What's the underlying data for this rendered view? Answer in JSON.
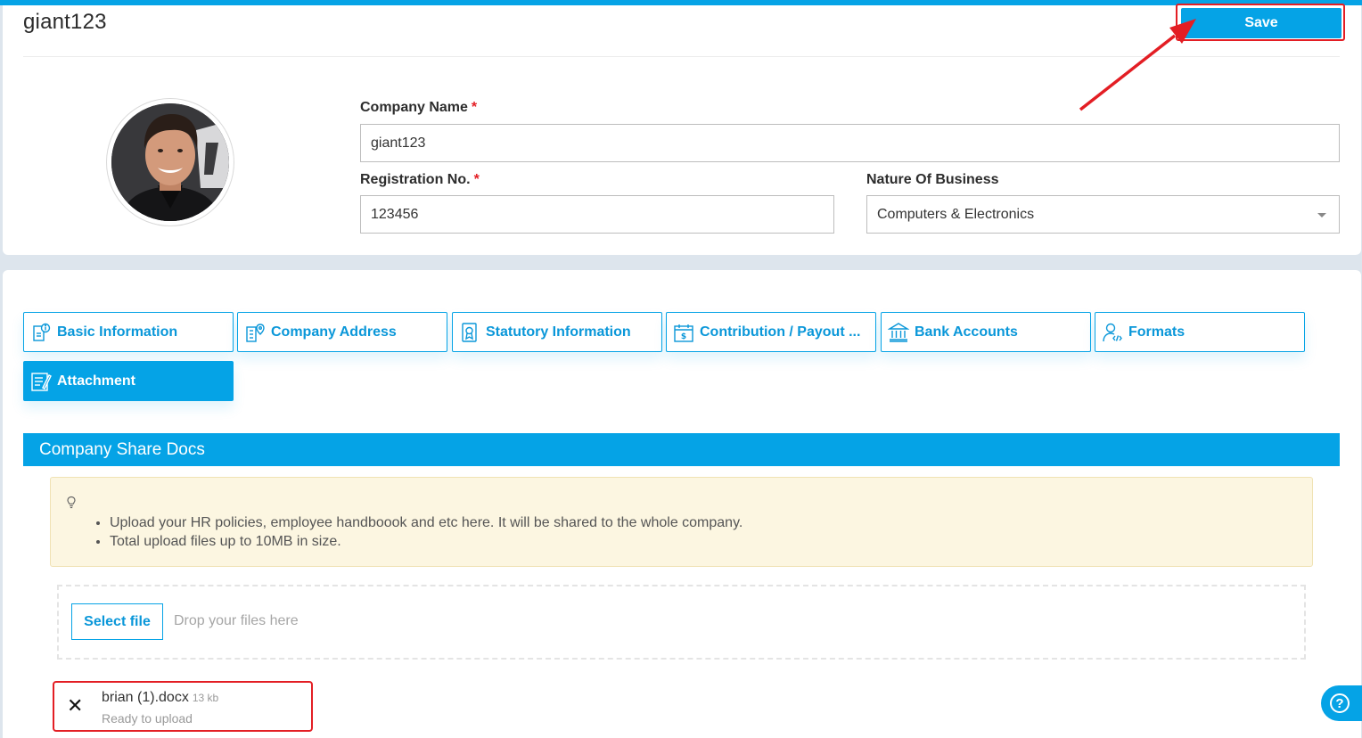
{
  "header": {
    "title": "giant123",
    "save_label": "Save"
  },
  "form": {
    "company_name": {
      "label": "Company Name",
      "required": "*",
      "value": "giant123"
    },
    "registration_no": {
      "label": "Registration No.",
      "required": "*",
      "value": "123456"
    },
    "nature_of_business": {
      "label": "Nature Of Business",
      "value": "Computers & Electronics"
    }
  },
  "tabs": [
    {
      "label": "Basic Information",
      "icon": "info-doc-icon",
      "active": false
    },
    {
      "label": "Company Address",
      "icon": "building-pin-icon",
      "active": false
    },
    {
      "label": "Statutory Information",
      "icon": "certificate-icon",
      "active": false
    },
    {
      "label": "Contribution / Payout ...",
      "icon": "calendar-dollar-icon",
      "active": false
    },
    {
      "label": "Bank Accounts",
      "icon": "bank-icon",
      "active": false
    },
    {
      "label": "Formats",
      "icon": "user-code-icon",
      "active": false
    },
    {
      "label": "Attachment",
      "icon": "attachment-doc-icon",
      "active": true
    }
  ],
  "section": {
    "title": "Company Share Docs",
    "tips": [
      "Upload your HR policies, employee handboook and etc here. It will be shared to the whole company.",
      "Total upload files up to 10MB in size."
    ]
  },
  "upload": {
    "select_label": "Select file",
    "drop_hint": "Drop your files here",
    "file": {
      "name": "brian (1).docx",
      "size": "13 kb",
      "status": "Ready to upload"
    }
  },
  "colors": {
    "accent": "#05a3e6",
    "highlight": "#e31e24",
    "info_bg": "#fcf6e1"
  }
}
